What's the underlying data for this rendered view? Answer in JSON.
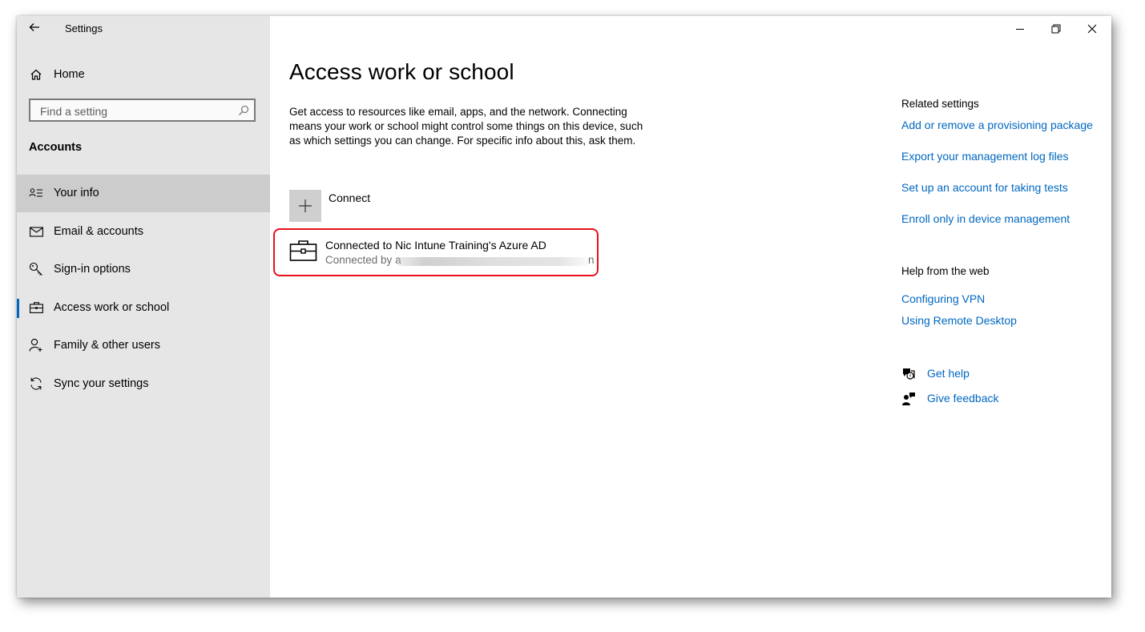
{
  "window": {
    "title": "Settings"
  },
  "sidebar": {
    "home_label": "Home",
    "search_placeholder": "Find a setting",
    "section_heading": "Accounts",
    "items": [
      {
        "label": "Your info",
        "icon": "person-card-icon"
      },
      {
        "label": "Email & accounts",
        "icon": "mail-icon"
      },
      {
        "label": "Sign-in options",
        "icon": "key-icon"
      },
      {
        "label": "Access work or school",
        "icon": "briefcase-icon"
      },
      {
        "label": "Family & other users",
        "icon": "person-add-icon"
      },
      {
        "label": "Sync your settings",
        "icon": "sync-icon"
      }
    ],
    "selected_index": 3,
    "hover_index": 0
  },
  "main": {
    "title": "Access work or school",
    "description": "Get access to resources like email, apps, and the network. Connecting means your work or school might control some things on this device, such as which settings you can change. For specific info about this, ask them.",
    "connect_label": "Connect",
    "account": {
      "title": "Connected to Nic Intune Training's Azure AD",
      "subtitle_prefix": "Connected by ",
      "subtitle_visible_start": "a",
      "subtitle_visible_end": "n"
    }
  },
  "related": {
    "heading": "Related settings",
    "links": [
      "Add or remove a provisioning package",
      "Export your management log files",
      "Set up an account for taking tests",
      "Enroll only in device management"
    ],
    "help_heading": "Help from the web",
    "help_links": [
      "Configuring VPN",
      "Using Remote Desktop"
    ],
    "get_help": "Get help",
    "give_feedback": "Give feedback"
  },
  "colors": {
    "accent": "#0067c0",
    "sidebar_bg": "#e6e6e6",
    "highlight": "#e8101b"
  }
}
